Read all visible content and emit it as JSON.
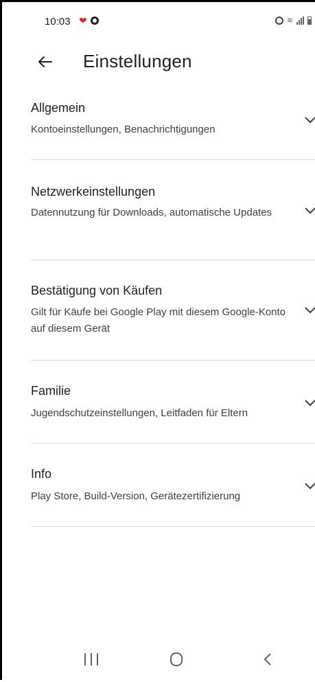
{
  "status_bar": {
    "time": "10:03",
    "icons": [
      "heart-icon",
      "app-notification-icon",
      "alarm-icon",
      "wifi-icon",
      "signal-icon",
      "battery-icon"
    ]
  },
  "header": {
    "back_icon": "arrow-left-icon",
    "title": "Einstellungen"
  },
  "settings": {
    "items": [
      {
        "title": "Allgemein",
        "subtitle": "Kontoeinstellungen, Benachrichtigungen",
        "icon": "chevron-down-icon"
      },
      {
        "title": "Netzwerkeinstellungen",
        "subtitle": "Datennutzung für Downloads, automatische Updates",
        "icon": "chevron-down-icon"
      },
      {
        "title": "Bestätigung von Käufen",
        "subtitle": "Gilt für Käufe bei Google Play mit diesem Google-Konto auf diesem Gerät",
        "icon": "chevron-down-icon"
      },
      {
        "title": "Familie",
        "subtitle": "Jugendschutzeinstellungen, Leitfaden für Eltern",
        "icon": "chevron-down-icon"
      },
      {
        "title": "Info",
        "subtitle": "Play Store, Build-Version, Gerätezertifizierung",
        "icon": "chevron-down-icon"
      }
    ]
  },
  "nav_bar": {
    "icons": [
      "recent-apps-icon",
      "home-icon",
      "back-icon"
    ]
  },
  "colors": {
    "text_primary": "#202124",
    "text_secondary": "#3c4043",
    "divider": "#dadce0",
    "icon_gray": "#5f6368",
    "heart_red": "#d93025"
  }
}
